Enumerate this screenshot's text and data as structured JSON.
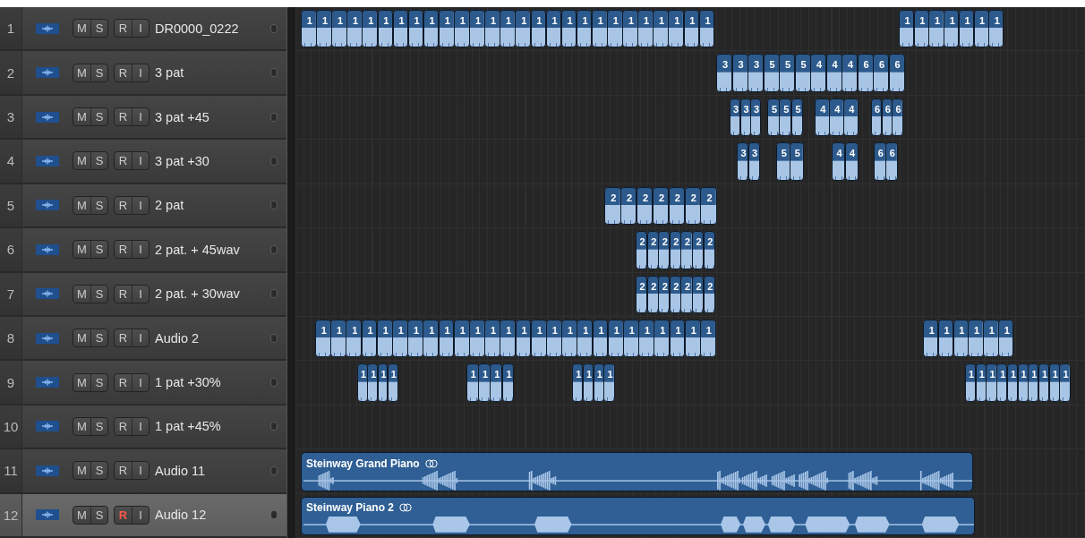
{
  "tracks": [
    {
      "number": "1",
      "name": "DR0000_0222",
      "selected": false,
      "record_armed": false,
      "mute": "M",
      "solo": "S",
      "record": "R",
      "input": "I",
      "regions": [
        {
          "kind": "pattern",
          "label": "1"
        },
        {
          "kind": "pattern",
          "label": "1"
        },
        {
          "kind": "pattern",
          "label": "1"
        },
        {
          "kind": "pattern",
          "label": "1"
        },
        {
          "kind": "pattern",
          "label": "1"
        },
        {
          "kind": "pattern",
          "label": "1"
        },
        {
          "kind": "pattern",
          "label": "1"
        },
        {
          "kind": "pattern",
          "label": "1"
        },
        {
          "kind": "pattern",
          "label": "1"
        },
        {
          "kind": "pattern",
          "label": "1"
        },
        {
          "kind": "pattern",
          "label": "1"
        },
        {
          "kind": "pattern",
          "label": "1"
        },
        {
          "kind": "pattern",
          "label": "1"
        },
        {
          "kind": "pattern",
          "label": "1"
        },
        {
          "kind": "pattern",
          "label": "1"
        },
        {
          "kind": "pattern",
          "label": "1"
        },
        {
          "kind": "pattern",
          "label": "1"
        },
        {
          "kind": "pattern",
          "label": "1"
        },
        {
          "kind": "pattern",
          "label": "1"
        },
        {
          "kind": "pattern",
          "label": "1"
        },
        {
          "kind": "pattern",
          "label": "1"
        },
        {
          "kind": "pattern",
          "label": "1"
        },
        {
          "kind": "pattern",
          "label": "1"
        },
        {
          "kind": "pattern",
          "label": "1"
        },
        {
          "kind": "pattern",
          "label": "1"
        },
        {
          "kind": "pattern",
          "label": "1"
        },
        {
          "kind": "pattern",
          "label": "1"
        },
        {
          "kind": "pattern",
          "label": "1"
        },
        {
          "kind": "pattern",
          "label": "1"
        },
        {
          "kind": "pattern",
          "label": "1"
        },
        {
          "kind": "pattern",
          "label": "1"
        },
        {
          "kind": "pattern",
          "label": "1"
        },
        {
          "kind": "pattern",
          "label": "1"
        },
        {
          "kind": "pattern",
          "label": "1"
        }
      ]
    },
    {
      "number": "2",
      "name": "3 pat",
      "selected": false,
      "record_armed": false,
      "mute": "M",
      "solo": "S",
      "record": "R",
      "input": "I",
      "regions": [
        {
          "kind": "pattern",
          "label": "3"
        },
        {
          "kind": "pattern",
          "label": "3"
        },
        {
          "kind": "pattern",
          "label": "3"
        },
        {
          "kind": "pattern",
          "label": "5"
        },
        {
          "kind": "pattern",
          "label": "5"
        },
        {
          "kind": "pattern",
          "label": "5"
        },
        {
          "kind": "pattern",
          "label": "4"
        },
        {
          "kind": "pattern",
          "label": "4"
        },
        {
          "kind": "pattern",
          "label": "4"
        },
        {
          "kind": "pattern",
          "label": "6"
        },
        {
          "kind": "pattern",
          "label": "6"
        },
        {
          "kind": "pattern",
          "label": "6"
        }
      ]
    },
    {
      "number": "3",
      "name": "3 pat +45",
      "selected": false,
      "record_armed": false,
      "mute": "M",
      "solo": "S",
      "record": "R",
      "input": "I",
      "regions": [
        {
          "kind": "pattern",
          "label": "3"
        },
        {
          "kind": "pattern",
          "label": "3"
        },
        {
          "kind": "pattern",
          "label": "3"
        },
        {
          "kind": "pattern",
          "label": "5"
        },
        {
          "kind": "pattern",
          "label": "5"
        },
        {
          "kind": "pattern",
          "label": "5"
        },
        {
          "kind": "pattern",
          "label": "4"
        },
        {
          "kind": "pattern",
          "label": "4"
        },
        {
          "kind": "pattern",
          "label": "4"
        },
        {
          "kind": "pattern",
          "label": "6"
        },
        {
          "kind": "pattern",
          "label": "6"
        },
        {
          "kind": "pattern",
          "label": "6"
        }
      ]
    },
    {
      "number": "4",
      "name": "3 pat +30",
      "selected": false,
      "record_armed": false,
      "mute": "M",
      "solo": "S",
      "record": "R",
      "input": "I",
      "regions": [
        {
          "kind": "pattern",
          "label": "3"
        },
        {
          "kind": "pattern",
          "label": "3"
        },
        {
          "kind": "pattern",
          "label": "5"
        },
        {
          "kind": "pattern",
          "label": "5"
        },
        {
          "kind": "pattern",
          "label": "4"
        },
        {
          "kind": "pattern",
          "label": "4"
        },
        {
          "kind": "pattern",
          "label": "6"
        },
        {
          "kind": "pattern",
          "label": "6"
        }
      ]
    },
    {
      "number": "5",
      "name": "2 pat",
      "selected": false,
      "record_armed": false,
      "mute": "M",
      "solo": "S",
      "record": "R",
      "input": "I",
      "regions": [
        {
          "kind": "pattern",
          "label": "2"
        },
        {
          "kind": "pattern",
          "label": "2"
        },
        {
          "kind": "pattern",
          "label": "2"
        },
        {
          "kind": "pattern",
          "label": "2"
        },
        {
          "kind": "pattern",
          "label": "2"
        },
        {
          "kind": "pattern",
          "label": "2"
        },
        {
          "kind": "pattern",
          "label": "2"
        }
      ]
    },
    {
      "number": "6",
      "name": "2 pat. + 45wav",
      "selected": false,
      "record_armed": false,
      "mute": "M",
      "solo": "S",
      "record": "R",
      "input": "I",
      "regions": [
        {
          "kind": "pattern",
          "label": "2"
        },
        {
          "kind": "pattern",
          "label": "2"
        },
        {
          "kind": "pattern",
          "label": "2"
        },
        {
          "kind": "pattern",
          "label": "2"
        },
        {
          "kind": "pattern",
          "label": "2"
        },
        {
          "kind": "pattern",
          "label": "2"
        },
        {
          "kind": "pattern",
          "label": "2"
        }
      ]
    },
    {
      "number": "7",
      "name": "2 pat. + 30wav",
      "selected": false,
      "record_armed": false,
      "mute": "M",
      "solo": "S",
      "record": "R",
      "input": "I",
      "regions": [
        {
          "kind": "pattern",
          "label": "2"
        },
        {
          "kind": "pattern",
          "label": "2"
        },
        {
          "kind": "pattern",
          "label": "2"
        },
        {
          "kind": "pattern",
          "label": "2"
        },
        {
          "kind": "pattern",
          "label": "2"
        },
        {
          "kind": "pattern",
          "label": "2"
        },
        {
          "kind": "pattern",
          "label": "2"
        }
      ]
    },
    {
      "number": "8",
      "name": "Audio 2",
      "selected": false,
      "record_armed": false,
      "mute": "M",
      "solo": "S",
      "record": "R",
      "input": "I",
      "regions": [
        {
          "kind": "pattern",
          "label": "1"
        },
        {
          "kind": "pattern",
          "label": "1"
        },
        {
          "kind": "pattern",
          "label": "1"
        },
        {
          "kind": "pattern",
          "label": "1"
        },
        {
          "kind": "pattern",
          "label": "1"
        },
        {
          "kind": "pattern",
          "label": "1"
        },
        {
          "kind": "pattern",
          "label": "1"
        },
        {
          "kind": "pattern",
          "label": "1"
        },
        {
          "kind": "pattern",
          "label": "1"
        },
        {
          "kind": "pattern",
          "label": "1"
        },
        {
          "kind": "pattern",
          "label": "1"
        },
        {
          "kind": "pattern",
          "label": "1"
        },
        {
          "kind": "pattern",
          "label": "1"
        },
        {
          "kind": "pattern",
          "label": "1"
        },
        {
          "kind": "pattern",
          "label": "1"
        },
        {
          "kind": "pattern",
          "label": "1"
        },
        {
          "kind": "pattern",
          "label": "1"
        },
        {
          "kind": "pattern",
          "label": "1"
        },
        {
          "kind": "pattern",
          "label": "1"
        },
        {
          "kind": "pattern",
          "label": "1"
        },
        {
          "kind": "pattern",
          "label": "1"
        },
        {
          "kind": "pattern",
          "label": "1"
        },
        {
          "kind": "pattern",
          "label": "1"
        },
        {
          "kind": "pattern",
          "label": "1"
        },
        {
          "kind": "pattern",
          "label": "1"
        },
        {
          "kind": "pattern",
          "label": "1"
        },
        {
          "kind": "pattern",
          "label": "1"
        },
        {
          "kind": "pattern",
          "label": "1"
        },
        {
          "kind": "pattern",
          "label": "1"
        },
        {
          "kind": "pattern",
          "label": "1"
        },
        {
          "kind": "pattern",
          "label": "1"
        },
        {
          "kind": "pattern",
          "label": "1"
        }
      ]
    },
    {
      "number": "9",
      "name": "1 pat +30%",
      "selected": false,
      "record_armed": false,
      "mute": "M",
      "solo": "S",
      "record": "R",
      "input": "I",
      "regions": [
        {
          "kind": "pattern",
          "label": "1"
        },
        {
          "kind": "pattern",
          "label": "1"
        },
        {
          "kind": "pattern",
          "label": "1"
        },
        {
          "kind": "pattern",
          "label": "1"
        },
        {
          "kind": "pattern",
          "label": "1"
        },
        {
          "kind": "pattern",
          "label": "1"
        },
        {
          "kind": "pattern",
          "label": "1"
        },
        {
          "kind": "pattern",
          "label": "1"
        },
        {
          "kind": "pattern",
          "label": "1"
        },
        {
          "kind": "pattern",
          "label": "1"
        },
        {
          "kind": "pattern",
          "label": "1"
        },
        {
          "kind": "pattern",
          "label": "1"
        },
        {
          "kind": "pattern",
          "label": "1"
        },
        {
          "kind": "pattern",
          "label": "1"
        },
        {
          "kind": "pattern",
          "label": "1"
        },
        {
          "kind": "pattern",
          "label": "1"
        },
        {
          "kind": "pattern",
          "label": "1"
        },
        {
          "kind": "pattern",
          "label": "1"
        },
        {
          "kind": "pattern",
          "label": "1"
        },
        {
          "kind": "pattern",
          "label": "1"
        },
        {
          "kind": "pattern",
          "label": "1"
        },
        {
          "kind": "pattern",
          "label": "1"
        }
      ]
    },
    {
      "number": "10",
      "name": "1 pat +45%",
      "selected": false,
      "record_armed": false,
      "mute": "M",
      "solo": "S",
      "record": "R",
      "input": "I"
    },
    {
      "number": "11",
      "name": "Audio 11",
      "selected": false,
      "record_armed": false,
      "mute": "M",
      "solo": "S",
      "record": "R",
      "input": "I",
      "regions": [
        {
          "kind": "audio",
          "label": "Steinway Grand Piano",
          "looped": true
        }
      ]
    },
    {
      "number": "12",
      "name": "Audio 12",
      "selected": true,
      "record_armed": true,
      "mute": "M",
      "solo": "S",
      "record": "R",
      "input": "I",
      "regions": [
        {
          "kind": "audio",
          "label": "Steinway Piano 2",
          "looped": true
        }
      ]
    }
  ]
}
